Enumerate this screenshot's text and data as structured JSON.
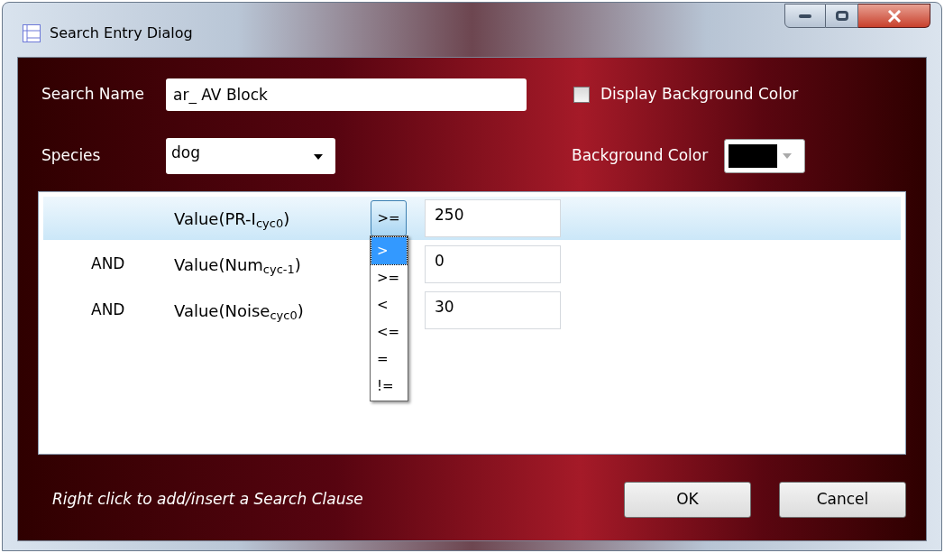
{
  "window": {
    "title": "Search Entry Dialog"
  },
  "search_name": {
    "label": "Search Name",
    "value": "ar_ AV Block"
  },
  "display_background_color": {
    "label": "Display Background Color",
    "checked": false
  },
  "species": {
    "label": "Species",
    "value": "dog"
  },
  "background_color": {
    "label": "Background Color"
  },
  "clauses": [
    {
      "label": "Value(PR-I$_{cyc0}$)",
      "operator": ">=",
      "value": "250",
      "selected": true
    },
    {
      "connector": "AND",
      "label": "Value(Num$_{cyc-1}$)",
      "value": "0",
      "selected": false
    },
    {
      "connector": "AND",
      "label": "Value(Noise$_{cyc0}$)",
      "value": "30",
      "selected": false
    }
  ],
  "operator_menu": {
    "options": [
      {
        "label": ">",
        "selected": true
      },
      {
        "label": ">=",
        "selected": false
      },
      {
        "label": "<",
        "selected": false
      },
      {
        "label": "<=",
        "selected": false
      },
      {
        "label": "=",
        "selected": false
      },
      {
        "label": "!=",
        "selected": false
      }
    ]
  },
  "hint": "Right click to add/insert a Search Clause",
  "buttons": [
    "OK",
    "Cancel"
  ]
}
